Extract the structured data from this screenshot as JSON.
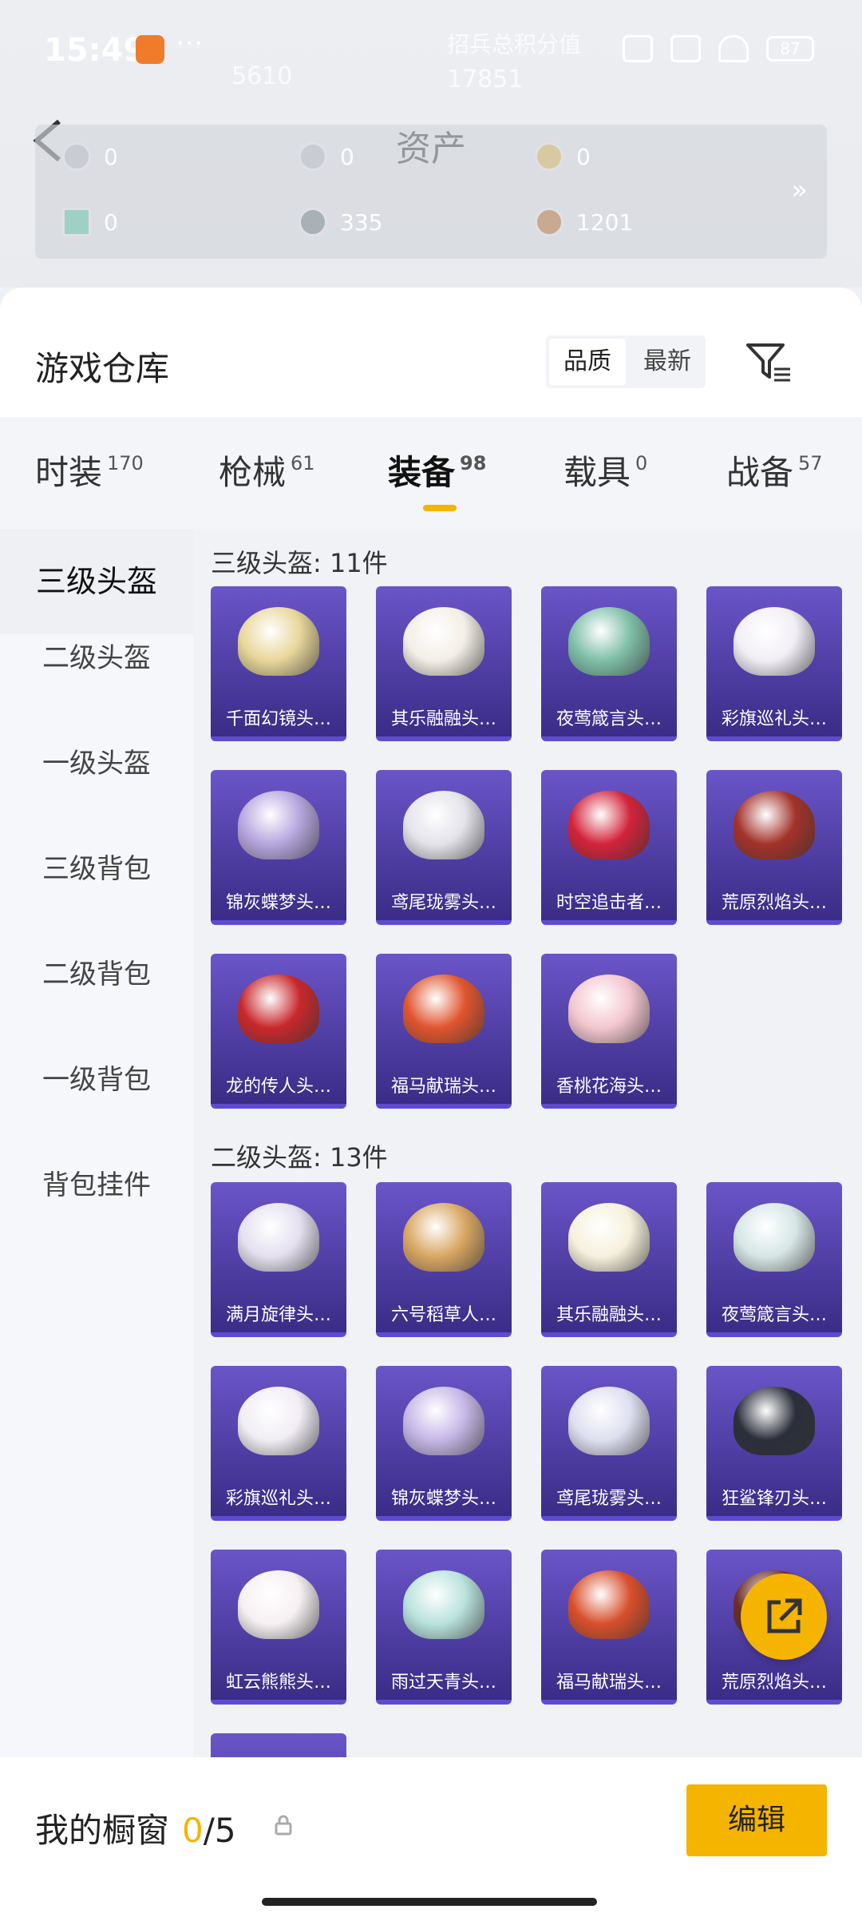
{
  "status": {
    "time": "15:49",
    "dots": "···",
    "battery": "87"
  },
  "header": {
    "title": "资产",
    "ghost_rank": "5610",
    "ghost_score": "17851",
    "ghost_text": "招兵总积分值",
    "assets": [
      {
        "value": "0",
        "icon": "gem-icon"
      },
      {
        "value": "0",
        "icon": "coin-icon"
      },
      {
        "value": "0",
        "icon": "medal-icon"
      },
      {
        "value": "0",
        "icon": "card-icon"
      },
      {
        "value": "335",
        "icon": "silver-coin-icon"
      },
      {
        "value": "1201",
        "icon": "bronze-coin-icon"
      }
    ],
    "more": "»"
  },
  "warehouse": {
    "title": "游戏仓库",
    "sort_options": [
      "品质",
      "最新"
    ],
    "sort_selected": "品质"
  },
  "tabs": [
    {
      "label": "时装",
      "count": "170"
    },
    {
      "label": "枪械",
      "count": "61"
    },
    {
      "label": "装备",
      "count": "98",
      "active": true
    },
    {
      "label": "载具",
      "count": "0"
    },
    {
      "label": "战备",
      "count": "57"
    }
  ],
  "sidebar": [
    "三级头盔",
    "二级头盔",
    "一级头盔",
    "三级背包",
    "二级背包",
    "一级背包",
    "背包挂件"
  ],
  "sections": [
    {
      "title": "三级头盔: 11件",
      "items": [
        {
          "name": "千面幻镜头…",
          "color": "#e8d79a"
        },
        {
          "name": "其乐融融头…",
          "color": "#f3efe6"
        },
        {
          "name": "夜莺箴言头…",
          "color": "#7fbfa8"
        },
        {
          "name": "彩旗巡礼头…",
          "color": "#f2eef6"
        },
        {
          "name": "锦灰蝶梦头…",
          "color": "#b6a6de"
        },
        {
          "name": "鸢尾珑雾头…",
          "color": "#e3e3ea"
        },
        {
          "name": "时空追击者…",
          "color": "#d2233a"
        },
        {
          "name": "荒原烈焰头…",
          "color": "#a3322a"
        },
        {
          "name": "龙的传人头…",
          "color": "#c8282c"
        },
        {
          "name": "福马献瑞头…",
          "color": "#e0552e"
        },
        {
          "name": "香桃花海头…",
          "color": "#f3c6cf"
        }
      ]
    },
    {
      "title": "二级头盔: 13件",
      "items": [
        {
          "name": "满月旋律头…",
          "color": "#e4e0f0"
        },
        {
          "name": "六号稻草人…",
          "color": "#d9a763"
        },
        {
          "name": "其乐融融头…",
          "color": "#f6f0dc"
        },
        {
          "name": "夜莺箴言头…",
          "color": "#d7e6e6"
        },
        {
          "name": "彩旗巡礼头…",
          "color": "#f1edf4"
        },
        {
          "name": "锦灰蝶梦头…",
          "color": "#c5b7e6"
        },
        {
          "name": "鸢尾珑雾头…",
          "color": "#dedff0"
        },
        {
          "name": "狂鲨锋刃头…",
          "color": "#2b2e3b"
        },
        {
          "name": "虹云熊熊头…",
          "color": "#f6f0f2"
        },
        {
          "name": "雨过天青头…",
          "color": "#b9e3dd"
        },
        {
          "name": "福马献瑞头…",
          "color": "#d84f2c"
        },
        {
          "name": "荒原烈焰头…",
          "color": "#6d2f2b"
        }
      ]
    }
  ],
  "bottom": {
    "showcase_label": "我的橱窗",
    "showcase_count": "0",
    "showcase_total": "/5",
    "edit_label": "编辑"
  }
}
